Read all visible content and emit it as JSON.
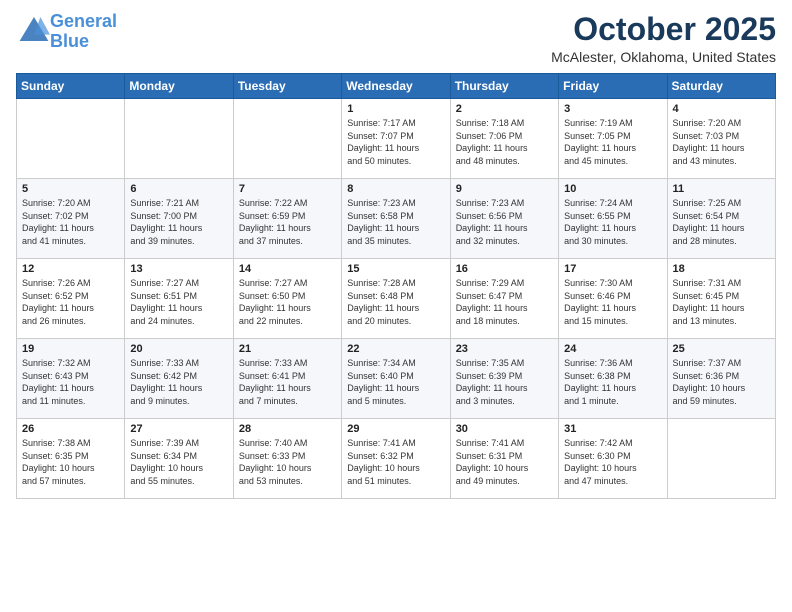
{
  "header": {
    "logo_line1": "General",
    "logo_line2": "Blue",
    "month": "October 2025",
    "location": "McAlester, Oklahoma, United States"
  },
  "weekdays": [
    "Sunday",
    "Monday",
    "Tuesday",
    "Wednesday",
    "Thursday",
    "Friday",
    "Saturday"
  ],
  "weeks": [
    [
      {
        "day": "",
        "info": ""
      },
      {
        "day": "",
        "info": ""
      },
      {
        "day": "",
        "info": ""
      },
      {
        "day": "1",
        "info": "Sunrise: 7:17 AM\nSunset: 7:07 PM\nDaylight: 11 hours\nand 50 minutes."
      },
      {
        "day": "2",
        "info": "Sunrise: 7:18 AM\nSunset: 7:06 PM\nDaylight: 11 hours\nand 48 minutes."
      },
      {
        "day": "3",
        "info": "Sunrise: 7:19 AM\nSunset: 7:05 PM\nDaylight: 11 hours\nand 45 minutes."
      },
      {
        "day": "4",
        "info": "Sunrise: 7:20 AM\nSunset: 7:03 PM\nDaylight: 11 hours\nand 43 minutes."
      }
    ],
    [
      {
        "day": "5",
        "info": "Sunrise: 7:20 AM\nSunset: 7:02 PM\nDaylight: 11 hours\nand 41 minutes."
      },
      {
        "day": "6",
        "info": "Sunrise: 7:21 AM\nSunset: 7:00 PM\nDaylight: 11 hours\nand 39 minutes."
      },
      {
        "day": "7",
        "info": "Sunrise: 7:22 AM\nSunset: 6:59 PM\nDaylight: 11 hours\nand 37 minutes."
      },
      {
        "day": "8",
        "info": "Sunrise: 7:23 AM\nSunset: 6:58 PM\nDaylight: 11 hours\nand 35 minutes."
      },
      {
        "day": "9",
        "info": "Sunrise: 7:23 AM\nSunset: 6:56 PM\nDaylight: 11 hours\nand 32 minutes."
      },
      {
        "day": "10",
        "info": "Sunrise: 7:24 AM\nSunset: 6:55 PM\nDaylight: 11 hours\nand 30 minutes."
      },
      {
        "day": "11",
        "info": "Sunrise: 7:25 AM\nSunset: 6:54 PM\nDaylight: 11 hours\nand 28 minutes."
      }
    ],
    [
      {
        "day": "12",
        "info": "Sunrise: 7:26 AM\nSunset: 6:52 PM\nDaylight: 11 hours\nand 26 minutes."
      },
      {
        "day": "13",
        "info": "Sunrise: 7:27 AM\nSunset: 6:51 PM\nDaylight: 11 hours\nand 24 minutes."
      },
      {
        "day": "14",
        "info": "Sunrise: 7:27 AM\nSunset: 6:50 PM\nDaylight: 11 hours\nand 22 minutes."
      },
      {
        "day": "15",
        "info": "Sunrise: 7:28 AM\nSunset: 6:48 PM\nDaylight: 11 hours\nand 20 minutes."
      },
      {
        "day": "16",
        "info": "Sunrise: 7:29 AM\nSunset: 6:47 PM\nDaylight: 11 hours\nand 18 minutes."
      },
      {
        "day": "17",
        "info": "Sunrise: 7:30 AM\nSunset: 6:46 PM\nDaylight: 11 hours\nand 15 minutes."
      },
      {
        "day": "18",
        "info": "Sunrise: 7:31 AM\nSunset: 6:45 PM\nDaylight: 11 hours\nand 13 minutes."
      }
    ],
    [
      {
        "day": "19",
        "info": "Sunrise: 7:32 AM\nSunset: 6:43 PM\nDaylight: 11 hours\nand 11 minutes."
      },
      {
        "day": "20",
        "info": "Sunrise: 7:33 AM\nSunset: 6:42 PM\nDaylight: 11 hours\nand 9 minutes."
      },
      {
        "day": "21",
        "info": "Sunrise: 7:33 AM\nSunset: 6:41 PM\nDaylight: 11 hours\nand 7 minutes."
      },
      {
        "day": "22",
        "info": "Sunrise: 7:34 AM\nSunset: 6:40 PM\nDaylight: 11 hours\nand 5 minutes."
      },
      {
        "day": "23",
        "info": "Sunrise: 7:35 AM\nSunset: 6:39 PM\nDaylight: 11 hours\nand 3 minutes."
      },
      {
        "day": "24",
        "info": "Sunrise: 7:36 AM\nSunset: 6:38 PM\nDaylight: 11 hours\nand 1 minute."
      },
      {
        "day": "25",
        "info": "Sunrise: 7:37 AM\nSunset: 6:36 PM\nDaylight: 10 hours\nand 59 minutes."
      }
    ],
    [
      {
        "day": "26",
        "info": "Sunrise: 7:38 AM\nSunset: 6:35 PM\nDaylight: 10 hours\nand 57 minutes."
      },
      {
        "day": "27",
        "info": "Sunrise: 7:39 AM\nSunset: 6:34 PM\nDaylight: 10 hours\nand 55 minutes."
      },
      {
        "day": "28",
        "info": "Sunrise: 7:40 AM\nSunset: 6:33 PM\nDaylight: 10 hours\nand 53 minutes."
      },
      {
        "day": "29",
        "info": "Sunrise: 7:41 AM\nSunset: 6:32 PM\nDaylight: 10 hours\nand 51 minutes."
      },
      {
        "day": "30",
        "info": "Sunrise: 7:41 AM\nSunset: 6:31 PM\nDaylight: 10 hours\nand 49 minutes."
      },
      {
        "day": "31",
        "info": "Sunrise: 7:42 AM\nSunset: 6:30 PM\nDaylight: 10 hours\nand 47 minutes."
      },
      {
        "day": "",
        "info": ""
      }
    ]
  ]
}
